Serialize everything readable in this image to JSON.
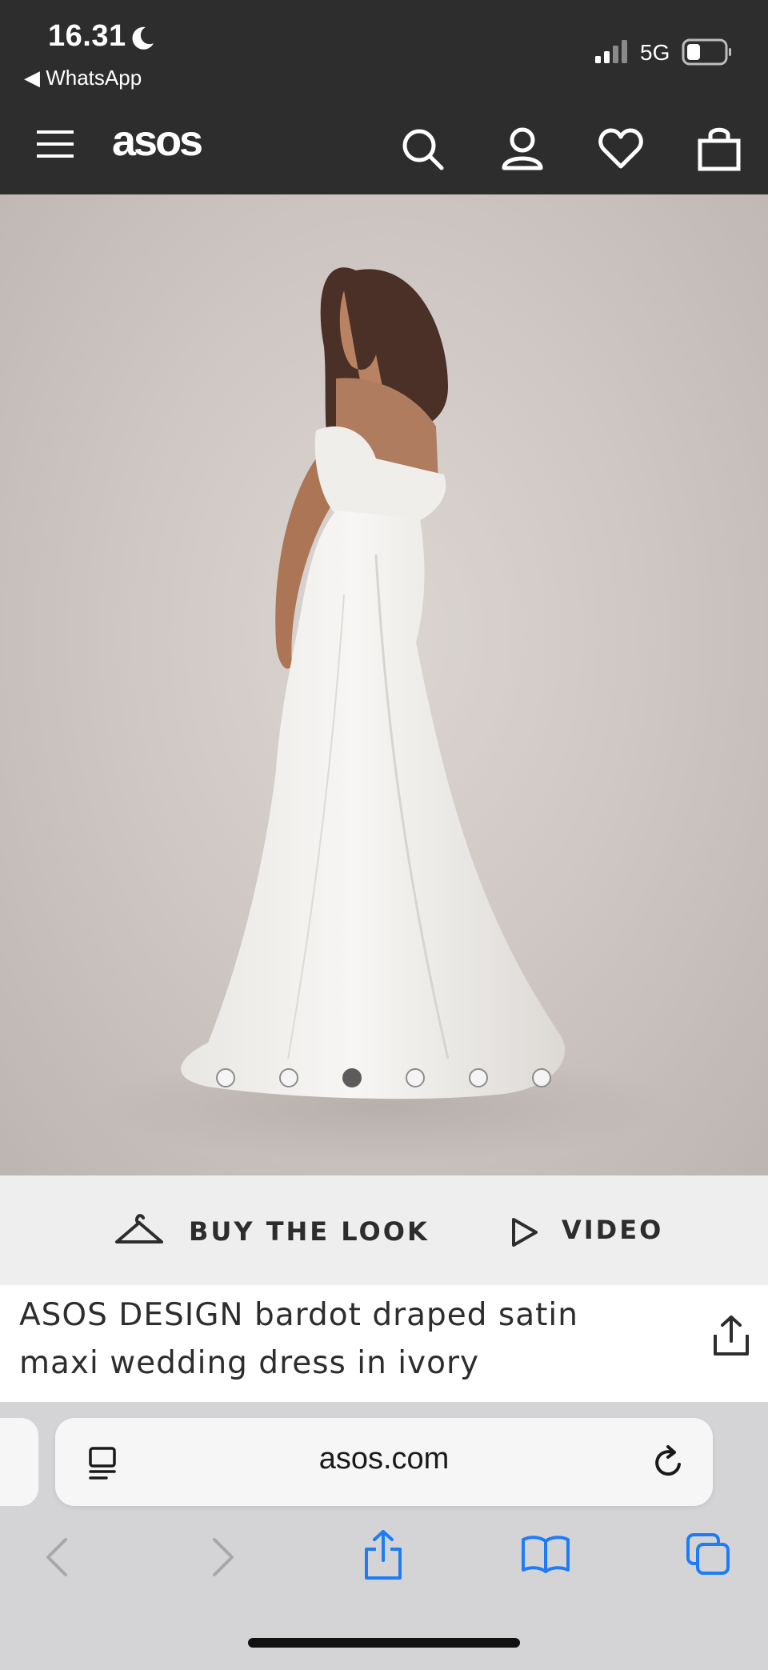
{
  "status_bar": {
    "time": "16.31",
    "back_app": "◀ WhatsApp",
    "network": "5G"
  },
  "header": {
    "logo": "asos",
    "icons": [
      "menu-icon",
      "search-icon",
      "account-icon",
      "heart-icon",
      "bag-icon"
    ]
  },
  "gallery": {
    "image_count": 6,
    "active_index": 3
  },
  "actions": {
    "buy_the_look": "BUY THE LOOK",
    "video": "VIDEO"
  },
  "product": {
    "title": "ASOS DESIGN bardot draped satin maxi wedding dress in ivory"
  },
  "browser": {
    "url": "asos.com",
    "toolbar_icons": [
      "back-icon",
      "forward-icon",
      "share-icon",
      "bookmarks-icon",
      "tabs-icon"
    ]
  },
  "colors": {
    "header_bg": "#2d2d2d",
    "action_bar_bg": "#eeeeee",
    "browser_accent": "#1e7cf6"
  }
}
